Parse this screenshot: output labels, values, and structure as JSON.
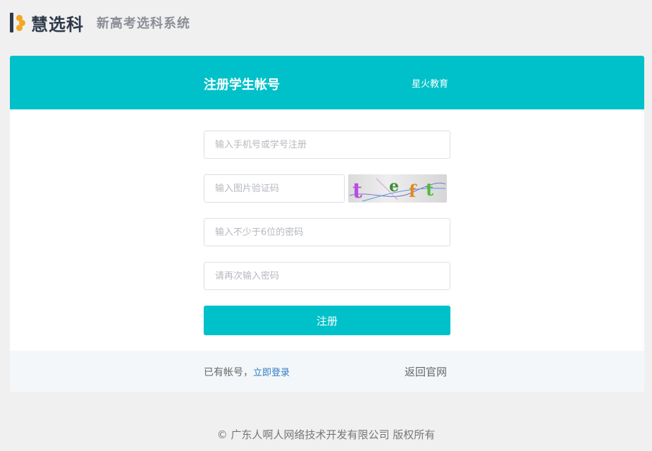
{
  "brand": {
    "name": "慧选科",
    "subtitle": "新高考选科系统",
    "colors": {
      "dark": "#2f3a4a",
      "accent": "#f5a623"
    }
  },
  "card": {
    "title": "注册学生帐号",
    "org": "星火教育",
    "accent_color": "#00c1c9"
  },
  "form": {
    "account_placeholder": "输入手机号或学号注册",
    "captcha_placeholder": "输入图片验证码",
    "captcha_text": "teft",
    "password_placeholder": "输入不少于6位的密码",
    "confirm_placeholder": "请再次输入密码",
    "submit_label": "注册"
  },
  "footer": {
    "has_account": "已有帐号，",
    "login_label": "立即登录",
    "back_label": "返回官网"
  },
  "copyright": "© 广东人啊人网络技术开发有限公司 版权所有"
}
